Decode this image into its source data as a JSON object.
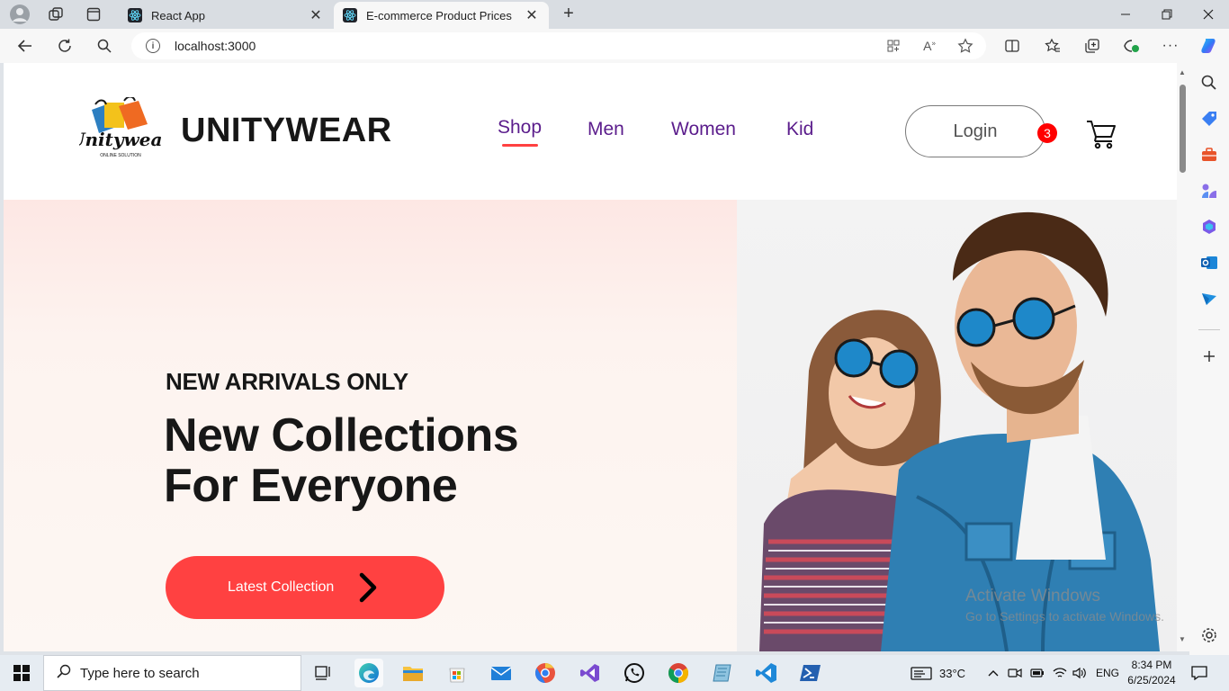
{
  "browser": {
    "tabs": [
      {
        "title": "React App",
        "active": false
      },
      {
        "title": "E-commerce Product Prices",
        "active": true
      }
    ],
    "url": "localhost:3000"
  },
  "site": {
    "brand": "UNITYWEAR",
    "logo_text": "Unitywear",
    "logo_tagline": "ONLINE SOLUTION",
    "menu": [
      {
        "label": "Shop",
        "active": true
      },
      {
        "label": "Men",
        "active": false
      },
      {
        "label": "Women",
        "active": false
      },
      {
        "label": "Kid",
        "active": false
      }
    ],
    "login_label": "Login",
    "cart_count": "3"
  },
  "hero": {
    "kicker": "NEW ARRIVALS ONLY",
    "title_line1": "New Collections",
    "title_line2": "For Everyone",
    "cta_label": "Latest Collection"
  },
  "watermark": {
    "line1": "Activate Windows",
    "line2": "Go to Settings to activate Windows."
  },
  "taskbar": {
    "search_placeholder": "Type here to search",
    "temperature": "33°C",
    "language": "ENG",
    "time": "8:34 PM",
    "date": "6/25/2024"
  },
  "colors": {
    "accent_red": "#ff4141",
    "menu_purple": "#5b1d8c",
    "badge_red": "#ff0000"
  }
}
